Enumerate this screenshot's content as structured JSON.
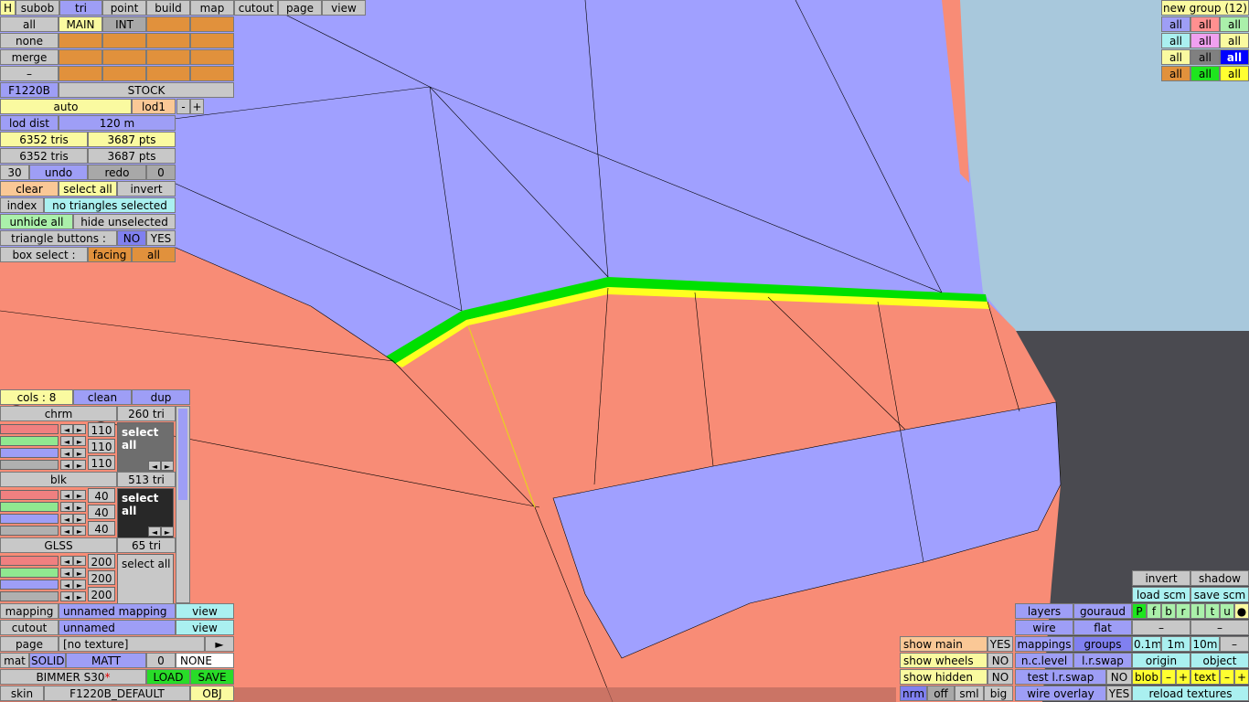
{
  "top_menu": {
    "h": "H",
    "items": [
      "subob",
      "tri",
      "point",
      "build",
      "map",
      "cutout",
      "page",
      "view"
    ]
  },
  "left_top": {
    "row_all": "all",
    "main": "MAIN",
    "int": "INT",
    "none": "none",
    "merge": "merge",
    "dash": "–",
    "model": "F1220B",
    "stock": "STOCK",
    "auto": "auto",
    "lod": "lod1",
    "minus": "-",
    "plus": "+",
    "lod_dist_label": "lod dist",
    "lod_dist_value": "120 m",
    "tris_a": "6352 tris",
    "pts_a": "3687 pts",
    "tris_b": "6352 tris",
    "pts_b": "3687 pts",
    "undo_count": "30",
    "undo": "undo",
    "redo": "redo",
    "redo_count": "0",
    "clear": "clear",
    "select_all": "select all",
    "invert": "invert",
    "index": "index",
    "no_selection": "no triangles selected",
    "unhide_all": "unhide all",
    "hide_unselected": "hide unselected",
    "tri_buttons": "triangle buttons :",
    "no": "NO",
    "yes": "YES",
    "box_select": "box select :",
    "facing": "facing",
    "box_all": "all"
  },
  "materials": {
    "cols": "cols : 8",
    "clean": "clean",
    "dup": "dup",
    "items": [
      {
        "name": "chrm",
        "tris": "260 tri",
        "r": "110",
        "g": "110",
        "b": "110",
        "select": "select all"
      },
      {
        "name": "blk",
        "tris": "513 tri",
        "r": "40",
        "g": "40",
        "b": "40",
        "select": "select all"
      },
      {
        "name": "GLSS",
        "tris": "65 tri",
        "r": "200",
        "g": "200",
        "b": "200",
        "select": "select all"
      }
    ]
  },
  "left_bottom": {
    "mapping_label": "mapping",
    "mapping_value": "unnamed mapping",
    "view1": "view",
    "cutout_label": "cutout",
    "cutout_value": "unnamed",
    "view2": "view",
    "page_label": "page",
    "page_value": "[no texture]",
    "play": "►",
    "mat": "mat",
    "solid": "SOLID",
    "matt": "MATT",
    "zero": "0",
    "none": "NONE",
    "car": "BIMMER S30",
    "star": "*",
    "load": "LOAD",
    "save": "SAVE",
    "skin_label": "skin",
    "skin_value": "F1220B_DEFAULT",
    "obj": "OBJ"
  },
  "groups": {
    "title": "new group (12)",
    "all": "all"
  },
  "bottom_right": {
    "show_main": "show main",
    "show_main_v": "YES",
    "show_wheels": "show wheels",
    "show_wheels_v": "NO",
    "show_hidden": "show hidden",
    "show_hidden_v": "NO",
    "nrm": "nrm",
    "off": "off",
    "sml": "sml",
    "big": "big",
    "layers": "layers",
    "gouraud": "gouraud",
    "wire": "wire",
    "flat": "flat",
    "mappings": "mappings",
    "groups": "groups",
    "nclevel": "n.c.level",
    "lrswap": "l.r.swap",
    "test_lrswap": "test l.r.swap",
    "test_v": "NO",
    "wire_overlay": "wire overlay",
    "wire_overlay_v": "YES",
    "invert": "invert",
    "shadow": "shadow",
    "load_scm": "load scm",
    "save_scm": "save scm",
    "flags": [
      "P",
      "f",
      "b",
      "r",
      "l",
      "t",
      "u",
      "●"
    ],
    "dash": "–",
    "dist": [
      "0.1m",
      "1m",
      "10m",
      "–"
    ],
    "origin": "origin",
    "object": "object",
    "blob": "blob",
    "text": "text",
    "m": "–",
    "p": "+",
    "reload": "reload textures"
  }
}
